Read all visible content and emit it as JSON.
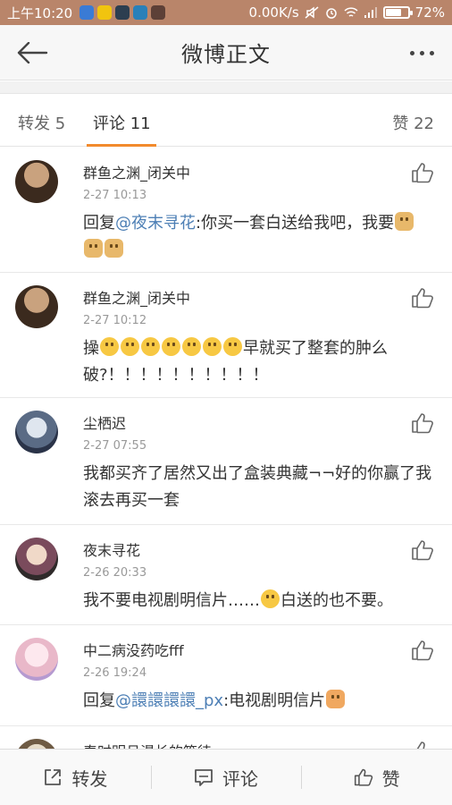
{
  "status_bar": {
    "time": "上午10:20",
    "network_speed": "0.00K/s",
    "battery": "72%",
    "battery_level": 0.72
  },
  "header": {
    "title": "微博正文"
  },
  "tabs": {
    "repost": "转发 5",
    "comment": "评论 11",
    "like": "赞 22"
  },
  "comments": [
    {
      "user": "群鱼之渊_闭关中",
      "time": "2-27 10:13",
      "prefix": "回复",
      "mention": "@夜末寻花",
      "body": ":你买一套白送给我吧，我要",
      "emojis": "dog dog dog"
    },
    {
      "user": "群鱼之渊_闭关中",
      "time": "2-27 10:12",
      "prefix": "操",
      "body": "早就买了整套的肿么破?！！！！！！！！！！"
    },
    {
      "user": "尘栖迟",
      "time": "2-27 07:55",
      "body": "我都买齐了居然又出了盒装典藏¬¬好的你赢了我滚去再买一套"
    },
    {
      "user": "夜末寻花",
      "time": "2-26 20:33",
      "body_a": "我不要电视剧明信片……",
      "body_b": "白送的也不要。"
    },
    {
      "user": "中二病没药吃fff",
      "time": "2-26 19:24",
      "prefix": "回复",
      "mention": "@譞譞譞譞_px",
      "body": ":电视剧明信片"
    },
    {
      "user": "春时明月漫长的等待"
    }
  ],
  "bottom_bar": {
    "repost": "转发",
    "comment": "评论",
    "like": "赞"
  },
  "colors": {
    "status_bar": "#b9856a",
    "accent": "#f28a2d",
    "mention": "#4d7fb5"
  }
}
